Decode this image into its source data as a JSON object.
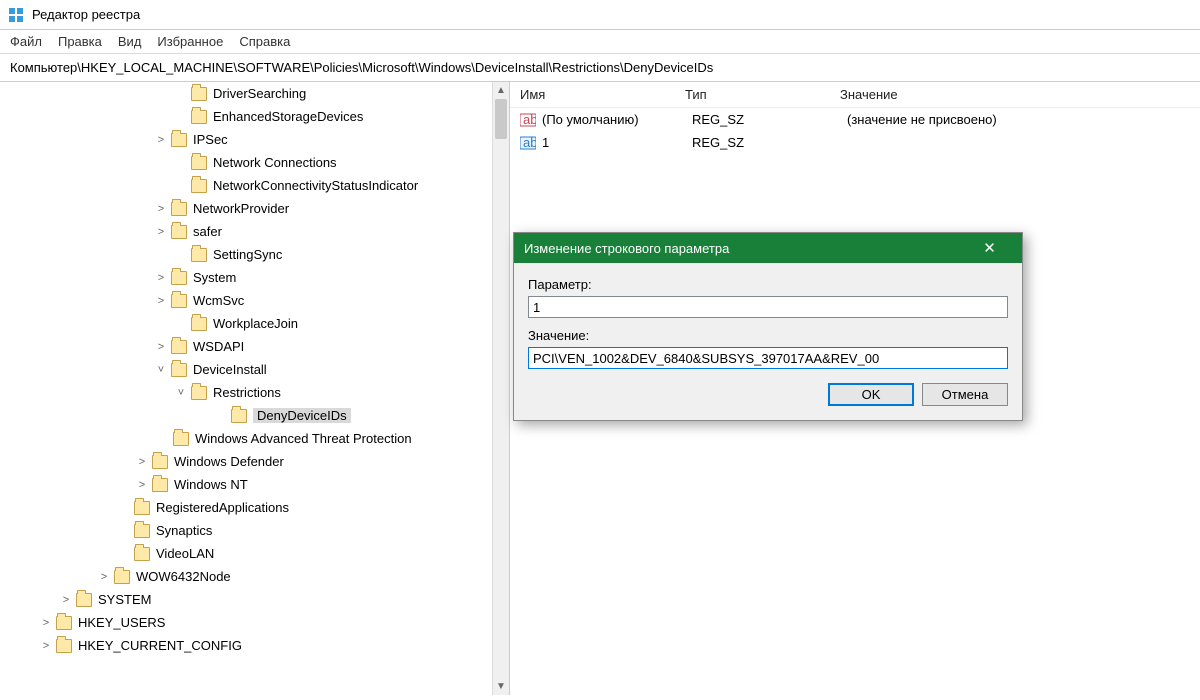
{
  "window": {
    "title": "Редактор реестра"
  },
  "menu": [
    "Файл",
    "Правка",
    "Вид",
    "Избранное",
    "Справка"
  ],
  "address": "Компьютер\\HKEY_LOCAL_MACHINE\\SOFTWARE\\Policies\\Microsoft\\Windows\\DeviceInstall\\Restrictions\\DenyDeviceIDs",
  "columns": {
    "name": "Имя",
    "type": "Тип",
    "value": "Значение"
  },
  "rows": [
    {
      "icon": "ab",
      "name": "(По умолчанию)",
      "type": "REG_SZ",
      "value": "(значение не присвоено)"
    },
    {
      "icon": "ab-new",
      "name": "1",
      "type": "REG_SZ",
      "value": ""
    }
  ],
  "tree": [
    {
      "indent": 175,
      "exp": "",
      "label": "DriverSearching"
    },
    {
      "indent": 175,
      "exp": "",
      "label": "EnhancedStorageDevices"
    },
    {
      "indent": 155,
      "exp": ">",
      "label": "IPSec"
    },
    {
      "indent": 175,
      "exp": "",
      "label": "Network Connections"
    },
    {
      "indent": 175,
      "exp": "",
      "label": "NetworkConnectivityStatusIndicator"
    },
    {
      "indent": 155,
      "exp": ">",
      "label": "NetworkProvider"
    },
    {
      "indent": 155,
      "exp": ">",
      "label": "safer"
    },
    {
      "indent": 175,
      "exp": "",
      "label": "SettingSync"
    },
    {
      "indent": 155,
      "exp": ">",
      "label": "System"
    },
    {
      "indent": 155,
      "exp": ">",
      "label": "WcmSvc"
    },
    {
      "indent": 175,
      "exp": "",
      "label": "WorkplaceJoin"
    },
    {
      "indent": 155,
      "exp": ">",
      "label": "WSDAPI"
    },
    {
      "indent": 155,
      "exp": "v",
      "label": "DeviceInstall"
    },
    {
      "indent": 175,
      "exp": "v",
      "label": "Restrictions"
    },
    {
      "indent": 215,
      "exp": "",
      "label": "DenyDeviceIDs",
      "selected": true
    },
    {
      "indent": 157,
      "exp": "",
      "label": "Windows Advanced Threat Protection"
    },
    {
      "indent": 136,
      "exp": ">",
      "label": "Windows Defender"
    },
    {
      "indent": 136,
      "exp": ">",
      "label": "Windows NT"
    },
    {
      "indent": 118,
      "exp": "",
      "label": "RegisteredApplications"
    },
    {
      "indent": 118,
      "exp": "",
      "label": "Synaptics"
    },
    {
      "indent": 118,
      "exp": "",
      "label": "VideoLAN"
    },
    {
      "indent": 98,
      "exp": ">",
      "label": "WOW6432Node"
    },
    {
      "indent": 60,
      "exp": ">",
      "label": "SYSTEM"
    },
    {
      "indent": 40,
      "exp": ">",
      "label": "HKEY_USERS"
    },
    {
      "indent": 40,
      "exp": ">",
      "label": "HKEY_CURRENT_CONFIG"
    }
  ],
  "dialog": {
    "title": "Изменение строкового параметра",
    "param_label": "Параметр:",
    "param_value": "1",
    "value_label": "Значение:",
    "value_value": "PCI\\VEN_1002&DEV_6840&SUBSYS_397017AA&REV_00",
    "ok": "OK",
    "cancel": "Отмена"
  }
}
